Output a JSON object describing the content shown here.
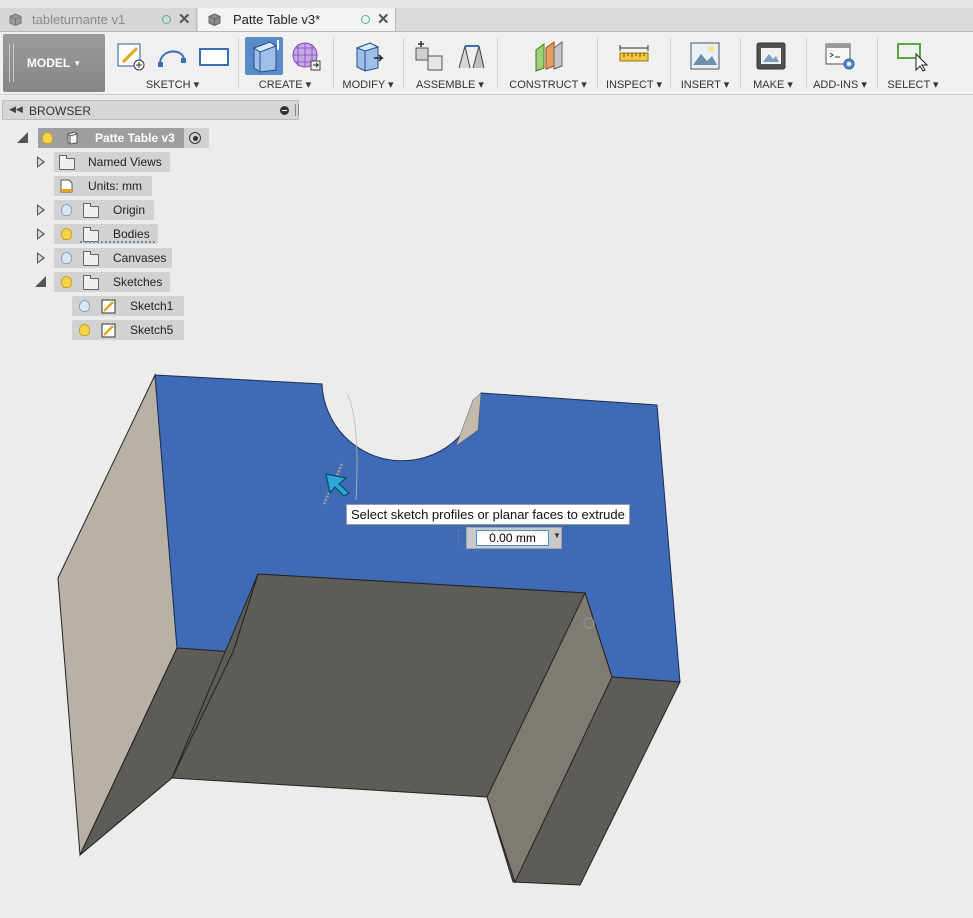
{
  "tabs": [
    {
      "label": "tableturnante v1",
      "active": false
    },
    {
      "label": "Patte Table v3*",
      "active": true
    }
  ],
  "toolbar": {
    "workspace": "MODEL",
    "groups": [
      {
        "label": "SKETCH"
      },
      {
        "label": "CREATE"
      },
      {
        "label": "MODIFY"
      },
      {
        "label": "ASSEMBLE"
      },
      {
        "label": "CONSTRUCT"
      },
      {
        "label": "INSPECT"
      },
      {
        "label": "INSERT"
      },
      {
        "label": "MAKE"
      },
      {
        "label": "ADD-INS"
      },
      {
        "label": "SELECT"
      }
    ]
  },
  "browser": {
    "title": "BROWSER",
    "root": "Patte Table v3",
    "items": [
      {
        "label": "Named Views"
      },
      {
        "label": "Units: mm"
      },
      {
        "label": "Origin"
      },
      {
        "label": "Bodies"
      },
      {
        "label": "Canvases"
      },
      {
        "label": "Sketches"
      },
      {
        "label": "Sketch1"
      },
      {
        "label": "Sketch5"
      }
    ]
  },
  "extrude": {
    "tooltip": "Select sketch profiles or planar faces to extrude",
    "distance": "0.00 mm"
  },
  "colors": {
    "selected_face": "#3f6ab5",
    "body_dark": "#5e5c57",
    "body_light": "#b8b1a5"
  }
}
